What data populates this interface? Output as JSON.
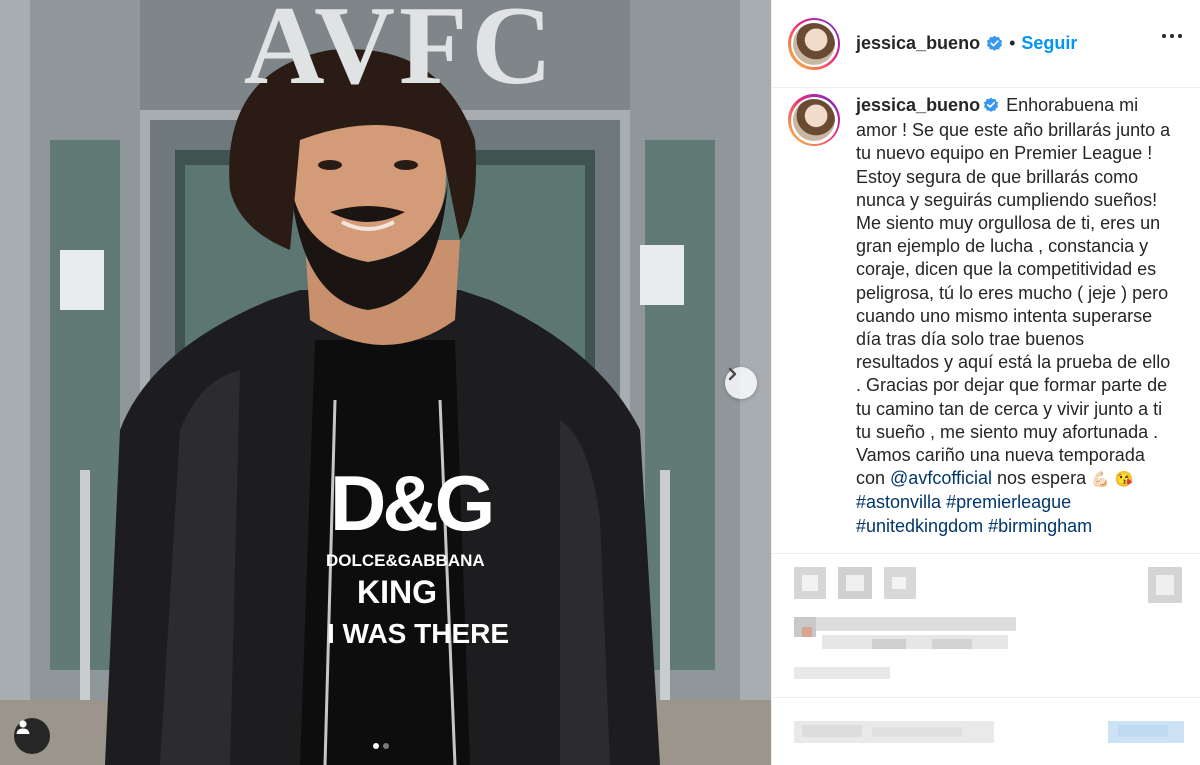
{
  "photo": {
    "sign_text": "AVFC",
    "shirt_logo": "D&G",
    "shirt_brand": "DOLCE&GABBANA",
    "shirt_line1": "KING",
    "shirt_line2": "I WAS THERE",
    "carousel_total": 2,
    "carousel_active": 1
  },
  "header": {
    "username": "jessica_bueno",
    "separator": "•",
    "follow_label": "Seguir"
  },
  "caption": {
    "username": "jessica_bueno",
    "text_part1": "Enhorabuena mi amor ! Se que este año brillarás junto a tu nuevo equipo en Premier League ! Estoy segura de que brillarás como nunca y seguirás cumpliendo sueños! Me siento muy orgullosa de ti, eres un gran ejemplo de lucha , constancia y coraje, dicen que la competitividad es peligrosa, tú lo eres mucho ( jeje ) pero cuando uno mismo intenta superarse día tras día solo trae buenos resultados y aquí está la prueba de ello . Gracias por dejar que formar parte de tu camino tan de cerca y vivir junto a ti tu sueño , me siento muy afortunada . Vamos cariño una nueva temporada con ",
    "mention": "@avfcofficial",
    "text_part2": " nos espera ",
    "emoji1": "💪🏻",
    "emoji2": "😘",
    "hashtag1": "#astonvilla",
    "hashtag2": "#premierleague",
    "hashtag3": "#unitedkingdom",
    "hashtag4": "#birmingham"
  },
  "colors": {
    "link_blue": "#0095f6",
    "hashtag_blue": "#00376b",
    "verified_blue": "#3897f0",
    "text": "#262626"
  }
}
